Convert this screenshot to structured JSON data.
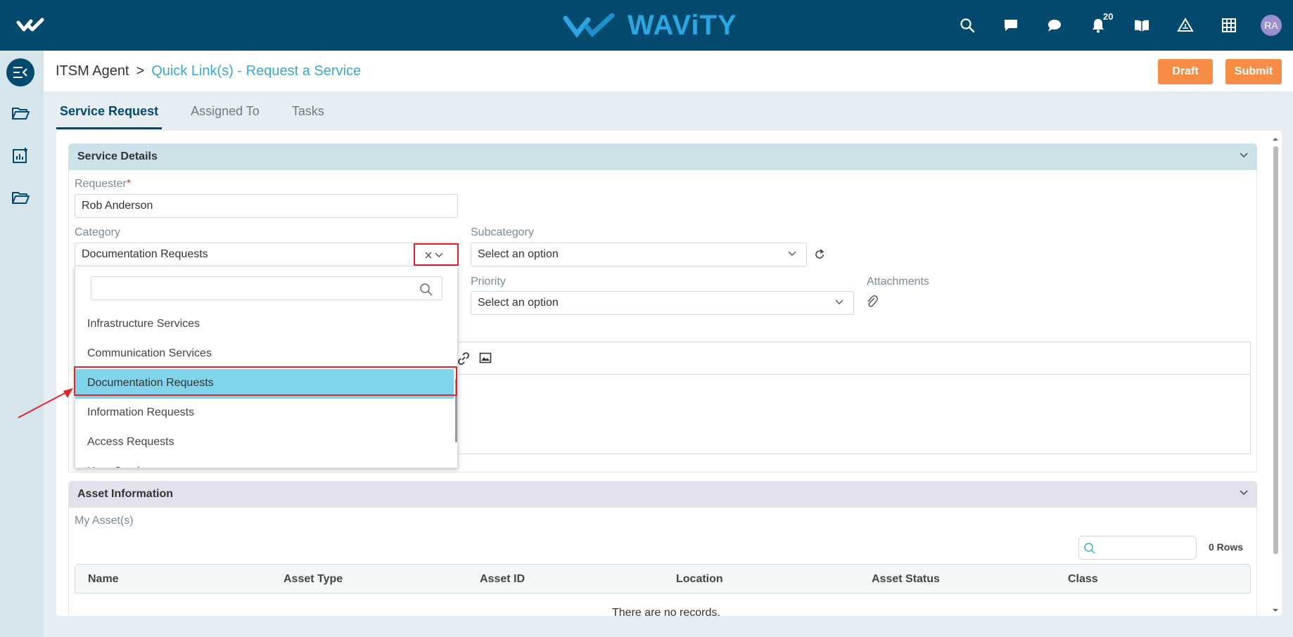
{
  "topbar": {
    "brand": "WAViTY",
    "notification_count": "20",
    "avatar_initials": "RA",
    "icons": [
      "search-icon",
      "chat-icon",
      "message-icon",
      "bell-icon",
      "book-icon",
      "triangle-icon",
      "grid-icon"
    ]
  },
  "header": {
    "breadcrumb_root": "ITSM Agent",
    "breadcrumb_sep": ">",
    "breadcrumb_current": "Quick Link(s) - Request a Service",
    "draft_label": "Draft",
    "submit_label": "Submit"
  },
  "tabs": [
    {
      "label": "Service Request",
      "active": true
    },
    {
      "label": "Assigned To",
      "active": false
    },
    {
      "label": "Tasks",
      "active": false
    }
  ],
  "service_details": {
    "title": "Service Details",
    "requester_label": "Requester",
    "requester_required": "*",
    "requester_value": "Rob Anderson",
    "category_label": "Category",
    "category_value": "Documentation Requests",
    "subcategory_label": "Subcategory",
    "subcategory_value": "Select an option",
    "priority_label": "Priority",
    "priority_value": "Select an option",
    "attachments_label": "Attachments"
  },
  "category_dropdown": {
    "search_value": "",
    "items": [
      {
        "label": "Infrastructure Services",
        "selected": false
      },
      {
        "label": "Communication Services",
        "selected": false
      },
      {
        "label": "Documentation Requests",
        "selected": true
      },
      {
        "label": "Information Requests",
        "selected": false
      },
      {
        "label": "Access Requests",
        "selected": false
      },
      {
        "label": "User Services",
        "selected": false
      }
    ]
  },
  "asset_information": {
    "title": "Asset Information",
    "my_assets_label": "My Asset(s)",
    "rows_count": "0 Rows",
    "columns": [
      "Name",
      "Asset Type",
      "Asset ID",
      "Location",
      "Asset Status",
      "Class"
    ],
    "empty_message": "There are no records."
  },
  "colors": {
    "topbar": "#034a6e",
    "accent": "#f68c46",
    "link": "#3ba7d6",
    "selected_item": "#7fd4ea",
    "annotation": "#e0242a"
  }
}
